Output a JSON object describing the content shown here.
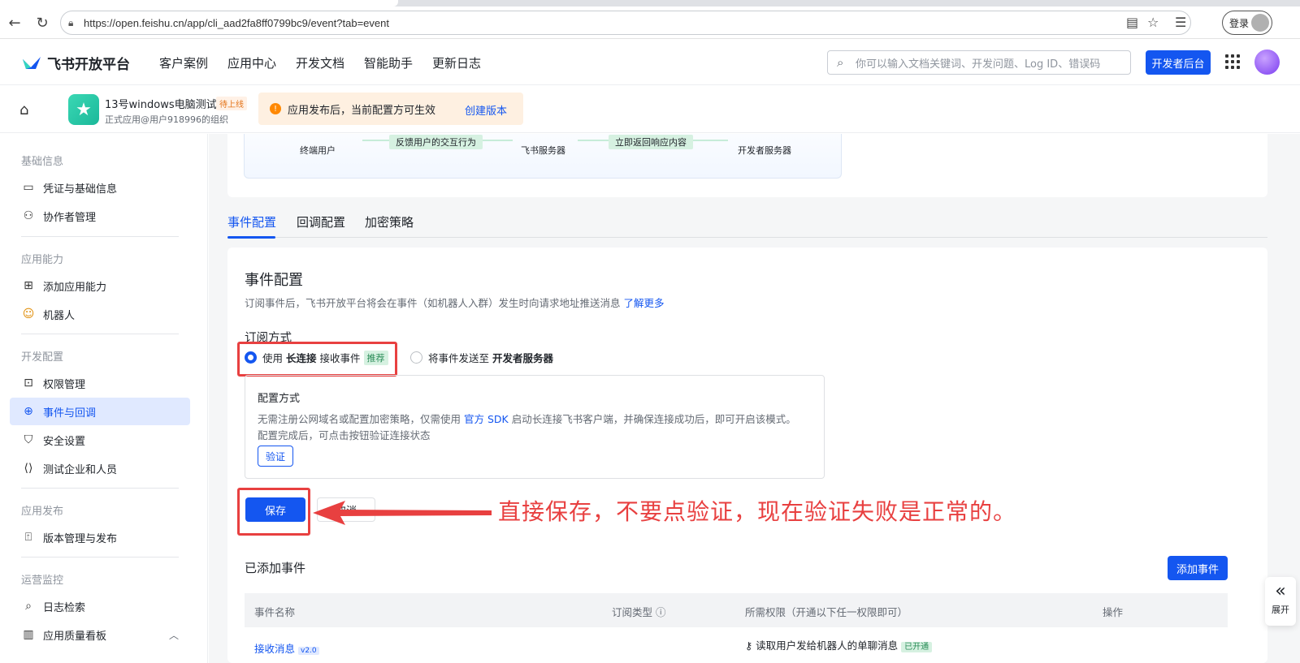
{
  "browser": {
    "url": "https://open.feishu.cn/app/cli_aad2fa8ff0799bc9/event?tab=event",
    "login_label": "登录"
  },
  "header": {
    "logo_text": "飞书开放平台",
    "nav": [
      "客户案例",
      "应用中心",
      "开发文档",
      "智能助手",
      "更新日志"
    ],
    "search_placeholder": "你可以输入文档关键词、开发问题、Log ID、错误码",
    "dev_console_label": "开发者后台"
  },
  "appbar": {
    "app_name": "13号windows电脑测试",
    "status_tag": "待上线",
    "subtitle": "正式应用@用户918996的组织",
    "notice_text": "应用发布后，当前配置方可生效",
    "notice_link": "创建版本"
  },
  "sidebar": {
    "sections": [
      {
        "title": "基础信息",
        "items": [
          {
            "label": "凭证与基础信息",
            "icon": "credential-icon"
          },
          {
            "label": "协作者管理",
            "icon": "user-add-icon"
          }
        ]
      },
      {
        "title": "应用能力",
        "items": [
          {
            "label": "添加应用能力",
            "icon": "apps-add-icon"
          },
          {
            "label": "机器人",
            "icon": "robot-icon"
          }
        ]
      },
      {
        "title": "开发配置",
        "items": [
          {
            "label": "权限管理",
            "icon": "lock-icon"
          },
          {
            "label": "事件与回调",
            "icon": "event-icon"
          },
          {
            "label": "安全设置",
            "icon": "shield-icon"
          },
          {
            "label": "测试企业和人员",
            "icon": "code-icon"
          }
        ]
      },
      {
        "title": "应用发布",
        "items": [
          {
            "label": "版本管理与发布",
            "icon": "upload-icon"
          }
        ]
      },
      {
        "title": "运营监控",
        "items": [
          {
            "label": "日志检索",
            "icon": "log-search-icon"
          },
          {
            "label": "应用质量看板",
            "icon": "chart-icon"
          }
        ]
      }
    ],
    "active_item": "事件与回调"
  },
  "flow": {
    "nodes": [
      "终端用户",
      "飞书服务器",
      "开发者服务器"
    ],
    "arrows": [
      "反馈用户的交互行为",
      "立即返回响应内容"
    ]
  },
  "tabs": [
    "事件配置",
    "回调配置",
    "加密策略"
  ],
  "config": {
    "title": "事件配置",
    "desc": "订阅事件后，飞书开放平台将会在事件（如机器人入群）发生时向请求地址推送消息",
    "desc_link": "了解更多",
    "subscribe_title": "订阅方式",
    "option1_pre": "使用",
    "option1_bold": "长连接",
    "option1_post": "接收事件",
    "option1_tag": "推荐",
    "option2_pre": "将事件发送至",
    "option2_bold": "开发者服务器",
    "mode_title": "配置方式",
    "mode_text1_pre": "无需注册公网域名或配置加密策略，仅需使用",
    "mode_text1_link": "官方 SDK",
    "mode_text1_post": "启动长连接飞书客户端，并确保连接成功后，即可开启该模式。",
    "mode_text2": "配置完成后，可点击按钮验证连接状态",
    "verify_label": "验证",
    "save_label": "保存",
    "cancel_label": "取消",
    "annotation": "直接保存，不要点验证，现在验证失败是正常的。"
  },
  "events": {
    "title": "已添加事件",
    "add_label": "添加事件",
    "columns": [
      "事件名称",
      "订阅类型",
      "所需权限（开通以下任一权限即可）",
      "操作"
    ],
    "rows": [
      {
        "name": "接收消息",
        "version": "v2.0",
        "permission": "读取用户发给机器人的单聊消息",
        "permission_status": "已开通"
      }
    ]
  },
  "expand_label": "展开"
}
